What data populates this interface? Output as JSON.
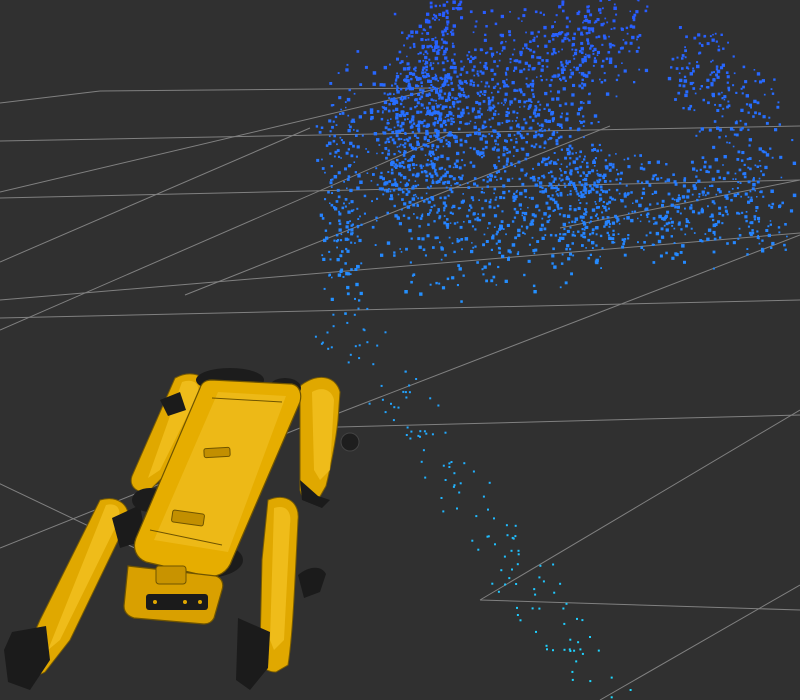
{
  "viewport": {
    "background_color": "#303030",
    "grid_color": "#9a9a9a",
    "pointcloud_color_far": "#2e6cff",
    "pointcloud_color_near": "#36c8ff",
    "robot_body_color": "#e0a800",
    "robot_joint_color": "#1a1a1a"
  }
}
